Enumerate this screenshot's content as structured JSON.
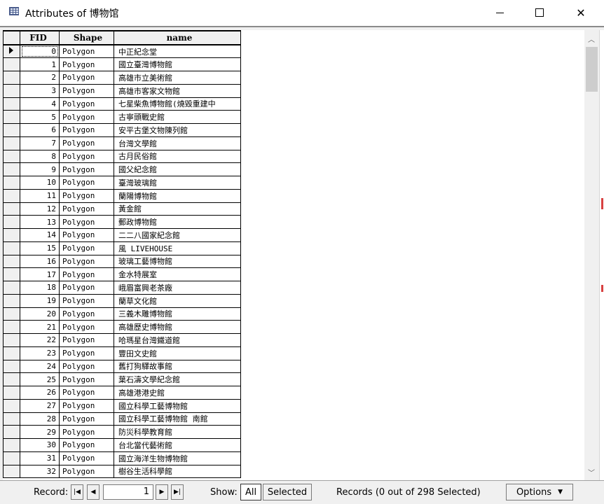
{
  "window": {
    "title": "Attributes of 博物馆",
    "minimize_icon": "minimize-icon",
    "maximize_icon": "maximize-icon",
    "close_icon": "close-icon"
  },
  "table": {
    "columns": [
      "FID",
      "Shape",
      "name"
    ],
    "rows": [
      [
        "0",
        "Polygon",
        "中正紀念堂"
      ],
      [
        "1",
        "Polygon",
        "國立臺灣博物館"
      ],
      [
        "2",
        "Polygon",
        "高雄市立美術館"
      ],
      [
        "3",
        "Polygon",
        "高雄市客家文物館"
      ],
      [
        "4",
        "Polygon",
        "七星柴魚博物館(燒毀重建中"
      ],
      [
        "5",
        "Polygon",
        "古寧頭戰史館"
      ],
      [
        "6",
        "Polygon",
        "安平古堡文物陳列館"
      ],
      [
        "7",
        "Polygon",
        "台灣文學館"
      ],
      [
        "8",
        "Polygon",
        "古月民俗館"
      ],
      [
        "9",
        "Polygon",
        "國父紀念館"
      ],
      [
        "10",
        "Polygon",
        "臺灣玻璃館"
      ],
      [
        "11",
        "Polygon",
        "蘭陽博物館"
      ],
      [
        "12",
        "Polygon",
        "黃金館"
      ],
      [
        "13",
        "Polygon",
        "郵政博物館"
      ],
      [
        "14",
        "Polygon",
        "二二八國家紀念館"
      ],
      [
        "15",
        "Polygon",
        "風 LIVEHOUSE"
      ],
      [
        "16",
        "Polygon",
        "玻璃工藝博物館"
      ],
      [
        "17",
        "Polygon",
        "金水特展室"
      ],
      [
        "18",
        "Polygon",
        "峨眉富興老茶廠"
      ],
      [
        "19",
        "Polygon",
        "蘭草文化館"
      ],
      [
        "20",
        "Polygon",
        "三義木雕博物館"
      ],
      [
        "21",
        "Polygon",
        "高雄歷史博物館"
      ],
      [
        "22",
        "Polygon",
        "哈瑪星台灣鐵道館"
      ],
      [
        "23",
        "Polygon",
        "豐田文史館"
      ],
      [
        "24",
        "Polygon",
        "舊打狗驛故事館"
      ],
      [
        "25",
        "Polygon",
        "葉石濤文學紀念館"
      ],
      [
        "26",
        "Polygon",
        "高雄港港史館"
      ],
      [
        "27",
        "Polygon",
        "國立科學工藝博物館"
      ],
      [
        "28",
        "Polygon",
        "國立科學工藝博物館 南館"
      ],
      [
        "29",
        "Polygon",
        "防災科學教育館"
      ],
      [
        "30",
        "Polygon",
        "台北當代藝術館"
      ],
      [
        "31",
        "Polygon",
        "國立海洋生物博物館"
      ],
      [
        "32",
        "Polygon",
        "樹谷生活科學館"
      ]
    ]
  },
  "status": {
    "record_label": "Record:",
    "record_value": "1",
    "show_label": "Show:",
    "all_label": "All",
    "selected_label": "Selected",
    "records_text": "Records (0 out of 298 Selected)",
    "options_label": "Options"
  },
  "colors": {
    "titlebar": "#ffffff",
    "chrome": "#f0f0f0",
    "scroll_thumb": "#cdcdcd"
  }
}
